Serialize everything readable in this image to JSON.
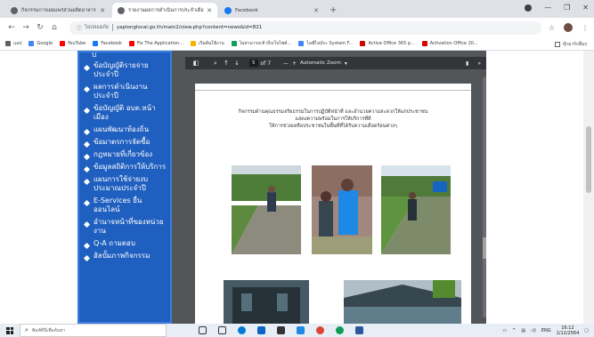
{
  "browser": {
    "tabs": [
      {
        "title": "กิจกรรมการเผยแพร่ส่วนผลิตอาหาร",
        "icon": "globe-icon",
        "active": false
      },
      {
        "title": "รายงานผลการดำเนินการประจำเดือน",
        "icon": "globe-icon",
        "active": true
      },
      {
        "title": "Facebook",
        "icon": "facebook-icon",
        "active": false
      }
    ],
    "new_tab": "+",
    "address": {
      "security": "ไม่ปลอดภัย",
      "url": "yaplonglocal.go.th/main2/view.php?content=news&id=821"
    },
    "bookmarks": [
      {
        "label": "แอป",
        "color": "#5f6368"
      },
      {
        "label": "Google",
        "color": "#4285f4"
      },
      {
        "label": "YouTube",
        "color": "#ff0000"
      },
      {
        "label": "Facebook",
        "color": "#1877f2"
      },
      {
        "label": "Fix The Application...",
        "color": "#ff0000"
      },
      {
        "label": "เริ่มต้นใช้งาน",
        "color": "#f4b400"
      },
      {
        "label": "ไม่สามารถเข้าถึงเว็บไซต์...",
        "color": "#0f9d58"
      },
      {
        "label": "ไลฟ์ไลน์ระ System F...",
        "color": "#4285f4"
      },
      {
        "label": "Active Office 365 p...",
        "color": "#d50000"
      },
      {
        "label": "Activation Office 20...",
        "color": "#d50000"
      }
    ],
    "bookmarks_other": "บุ๊กมาร์กอื่นๆ"
  },
  "sidebar": {
    "first_fragment": "ป",
    "items": [
      "ข้อบัญญัติรายจ่ายประจำปี",
      "ผลการดำเนินงานประจำปี",
      "ข้อบัญญัติ อบต.หน้าเมือง",
      "แผนพัฒนาท้องถิ่น",
      "ข้อมาตรการจัดซื้อ",
      "กฎหมายที่เกี่ยวข้อง",
      "ข้อมูลสถิติการให้บริการ",
      "แผนการใช้จ่ายงบประมาณประจำปี",
      "E-Services ยื่นออนไลน์",
      "อำนาจหน้าที่ของหน่วยงาน",
      "Q-A ถามตอบ",
      "อัลบั้มภาพกิจกรรม"
    ]
  },
  "pdf_viewer": {
    "page_current": "5",
    "page_total": "of 7",
    "zoom_minus": "—",
    "zoom_plus": "+",
    "zoom_label": "Automatic Zoom",
    "content": {
      "line1": "กิจกรรมด้านคุณธรรมจริยธรรมในการปฏิบัติหน้าที่ และอำนวยความสะดวกให้แก่ประชาชน",
      "line2": "แสดงความพร้อมในการให้บริการที่ดี",
      "line3": "ให้การช่วยเหลือประชาชนในพื้นที่ที่ได้รับความเดือดร้อนต่างๆ"
    }
  },
  "taskbar": {
    "search_placeholder": "พิมพ์ที่นี่เพื่อค้นหา",
    "lang": "ENG",
    "time": "16:12",
    "date": "1/12/2564"
  },
  "colors": {
    "sidebar_bg": "#1f5fbf",
    "pdf_bg": "#525659",
    "pdf_toolbar": "#323639"
  }
}
